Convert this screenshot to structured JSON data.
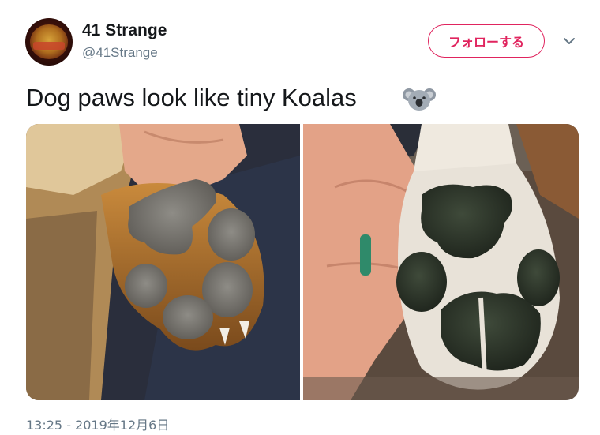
{
  "tweet": {
    "author": {
      "display_name": "41 Strange",
      "handle": "@41Strange"
    },
    "follow_label": "フォローする",
    "text": "Dog paws look like tiny Koalas",
    "emoji": "koala-emoji",
    "media": [
      {
        "icon": "dog-paw-photo-1"
      },
      {
        "icon": "dog-paw-photo-2"
      }
    ],
    "timestamp": "13:25 - 2019年12月6日"
  },
  "colors": {
    "accent": "#e0245e",
    "secondary_text": "#657786",
    "primary_text": "#14171a"
  }
}
